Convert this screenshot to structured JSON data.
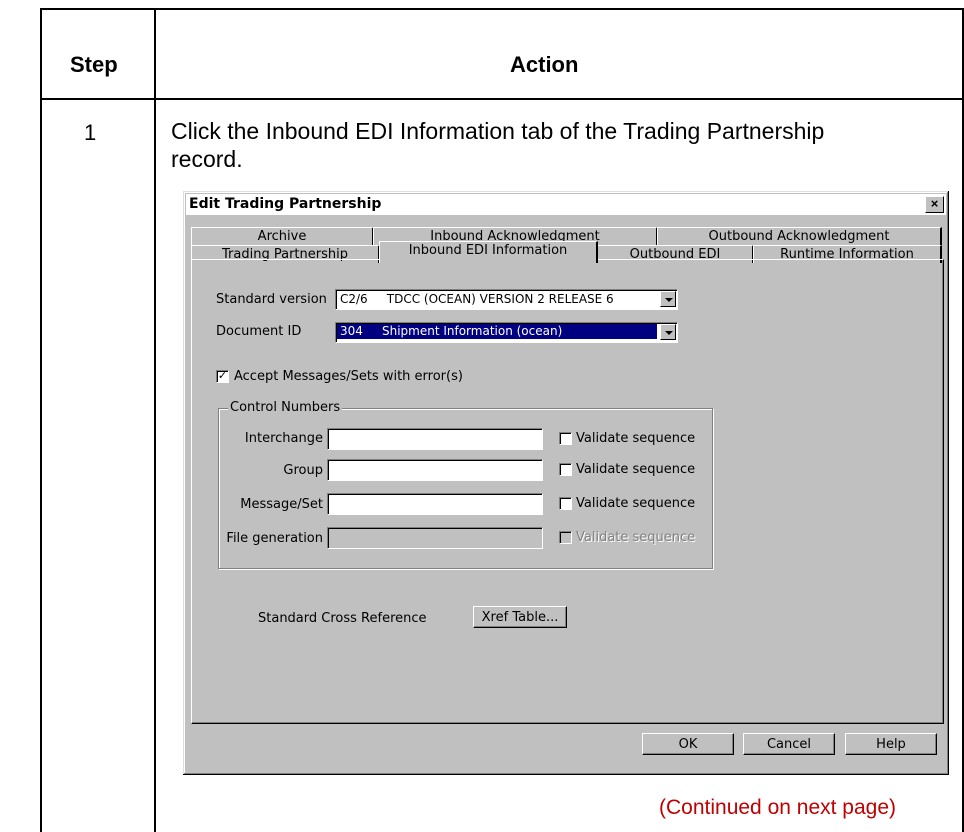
{
  "table": {
    "header_step": "Step",
    "header_action": "Action",
    "step_number": "1",
    "action_text": "Click the Inbound EDI Information tab of the Trading Partnership record.",
    "continued": "(Continued on next page)"
  },
  "dialog": {
    "title": "Edit Trading Partnership",
    "close_glyph": "×",
    "tabs_back": [
      "Archive",
      "Inbound Acknowledgment",
      "Outbound Acknowledgment"
    ],
    "tabs_front": [
      "Trading Partnership",
      "Inbound EDI Information",
      "Outbound EDI",
      "Runtime Information"
    ],
    "active_tab": "Inbound EDI Information",
    "standard_version_label": "Standard version",
    "standard_version_value": "C2/6     TDCC (OCEAN) VERSION 2 RELEASE 6",
    "document_id_label": "Document ID",
    "document_id_value": "304     Shipment Information (ocean)",
    "accept_label": "Accept Messages/Sets with error(s)",
    "accept_checked": "✓",
    "control_numbers_title": "Control Numbers",
    "control_rows": [
      {
        "label": "Interchange",
        "validate": "Validate sequence"
      },
      {
        "label": "Group",
        "validate": "Validate sequence"
      },
      {
        "label": "Message/Set",
        "validate": "Validate sequence"
      },
      {
        "label": "File generation",
        "validate": "Validate sequence"
      }
    ],
    "xref_label": "Standard Cross Reference",
    "xref_button": "Xref Table...",
    "ok_button": "OK",
    "cancel_button": "Cancel",
    "help_button": "Help",
    "selection_color": "#000080",
    "face_color": "#c0c0c0"
  }
}
